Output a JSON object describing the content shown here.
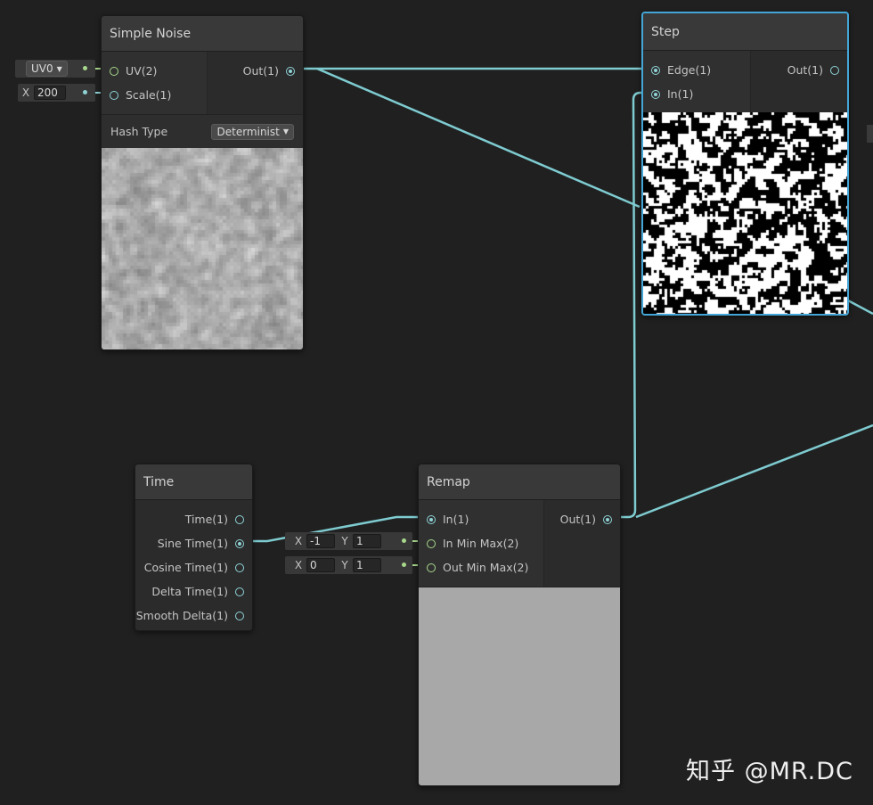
{
  "simple_noise": {
    "title": "Simple Noise",
    "inputs": [
      "UV(2)",
      "Scale(1)"
    ],
    "output": "Out(1)",
    "hash_type_label": "Hash Type",
    "hash_type_value": "Determinist",
    "uv_dropdown": "UV0",
    "scale_label": "X",
    "scale_value": "200"
  },
  "step": {
    "title": "Step",
    "inputs": [
      "Edge(1)",
      "In(1)"
    ],
    "output": "Out(1)"
  },
  "time": {
    "title": "Time",
    "outputs": [
      "Time(1)",
      "Sine Time(1)",
      "Cosine Time(1)",
      "Delta Time(1)",
      "Smooth Delta(1)"
    ]
  },
  "remap": {
    "title": "Remap",
    "inputs": [
      "In(1)",
      "In Min Max(2)",
      "Out Min Max(2)"
    ],
    "output": "Out(1)",
    "in_min_max": {
      "x_label": "X",
      "x": "-1",
      "y_label": "Y",
      "y": "1"
    },
    "out_min_max": {
      "x_label": "X",
      "x": "0",
      "y_label": "Y",
      "y": "1"
    }
  },
  "watermark": "知乎 @MR.DC",
  "colors": {
    "background": "#202020",
    "wire": "#7ecbd0",
    "port_float": "#8fd3d7",
    "port_vector2": "#a8d88c",
    "selected_border": "#44a6d6"
  }
}
